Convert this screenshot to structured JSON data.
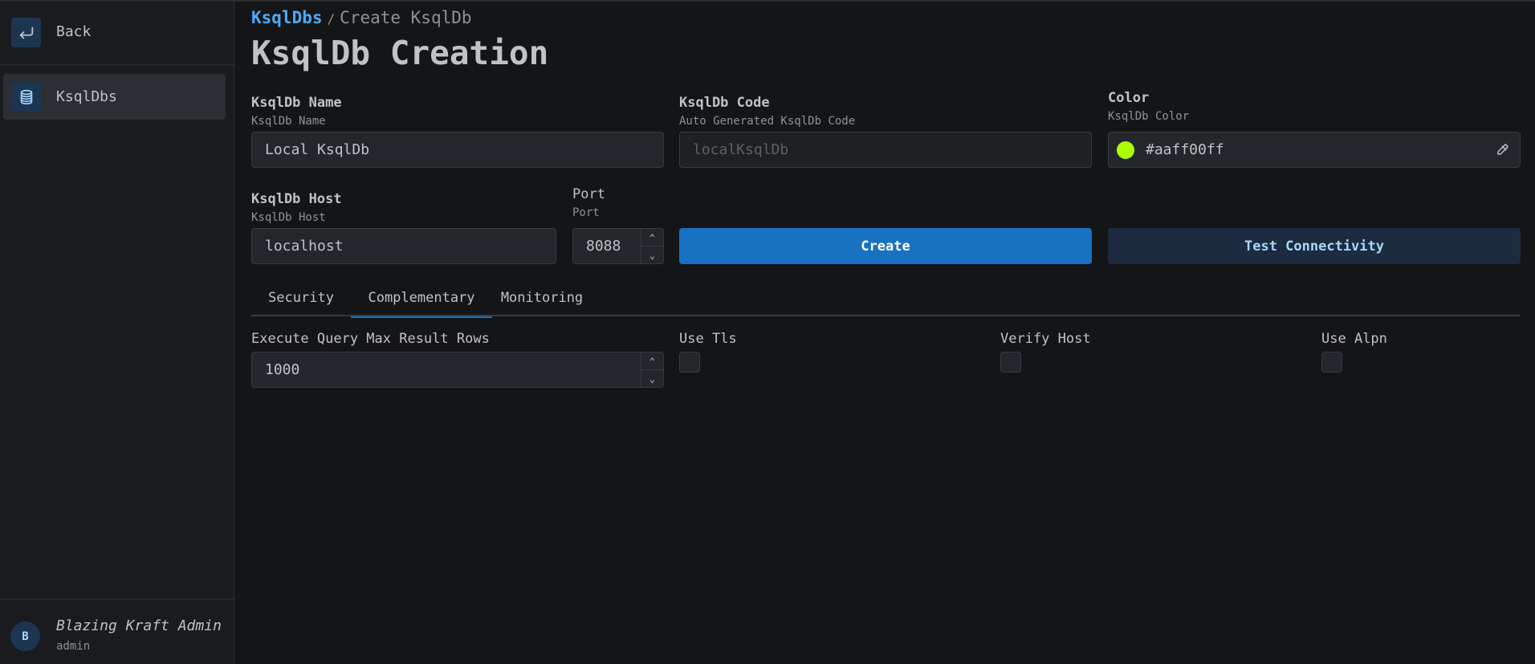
{
  "sidebar": {
    "back_label": "Back",
    "items": [
      {
        "label": "KsqlDbs",
        "icon": "database-icon"
      }
    ],
    "user": {
      "initial": "B",
      "name": "Blazing Kraft Admin",
      "role": "admin"
    }
  },
  "breadcrumb": {
    "link": "KsqlDbs",
    "separator": "/",
    "current": "Create KsqlDb"
  },
  "page_title": "KsqlDb Creation",
  "form": {
    "name": {
      "label": "KsqlDb Name",
      "description": "KsqlDb Name",
      "value": "Local KsqlDb"
    },
    "code": {
      "label": "KsqlDb Code",
      "description": "Auto Generated KsqlDb Code",
      "placeholder": "localKsqlDb"
    },
    "color": {
      "label": "Color",
      "description": "KsqlDb Color",
      "value": "#aaff00ff",
      "swatch": "#aaff00"
    },
    "host": {
      "label": "KsqlDb Host",
      "description": "KsqlDb Host",
      "value": "localhost"
    },
    "port": {
      "label": "Port",
      "description": "Port",
      "value": "8088"
    }
  },
  "buttons": {
    "create": "Create",
    "test": "Test Connectivity"
  },
  "tabs": [
    {
      "label": "Security",
      "active": false
    },
    {
      "label": "Complementary",
      "active": true
    },
    {
      "label": "Monitoring",
      "active": false
    }
  ],
  "complementary": {
    "max_rows": {
      "label": "Execute Query Max Result Rows",
      "value": "1000"
    },
    "use_tls": {
      "label": "Use Tls",
      "checked": false
    },
    "verify_host": {
      "label": "Verify Host",
      "checked": false
    },
    "use_alpn": {
      "label": "Use Alpn",
      "checked": false
    }
  },
  "colors": {
    "accent": "#1971c2",
    "link": "#4dabf7",
    "background": "#141517"
  }
}
